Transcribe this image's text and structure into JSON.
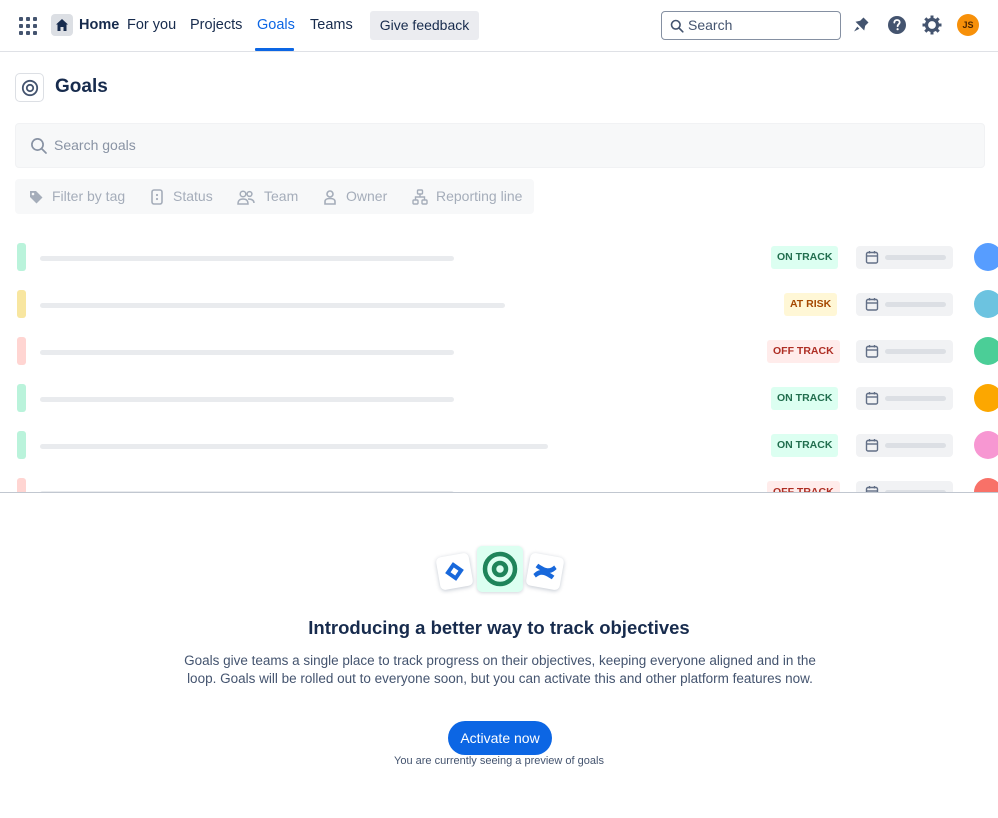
{
  "nav": {
    "home_label": "Home",
    "items": [
      "For you",
      "Projects",
      "Goals",
      "Teams"
    ],
    "active_item": "Goals",
    "feedback_label": "Give feedback",
    "search_placeholder": "Search",
    "user_initials": "JS",
    "avatar_color": "#f79009",
    "accent_color": "#0c66e4"
  },
  "page": {
    "title": "Goals",
    "search_placeholder": "Search goals",
    "filters": [
      {
        "label": "Filter by tag",
        "icon": "tag-icon"
      },
      {
        "label": "Status",
        "icon": "status-icon"
      },
      {
        "label": "Team",
        "icon": "team-icon"
      },
      {
        "label": "Owner",
        "icon": "owner-icon"
      },
      {
        "label": "Reporting line",
        "icon": "reporting-line-icon"
      }
    ]
  },
  "goals": [
    {
      "status": "ON TRACK",
      "status_color": "#216e4e",
      "status_bg": "#dcfff1",
      "stripe": "#baf3db",
      "avatar_color": "#579dff"
    },
    {
      "status": "AT RISK",
      "status_color": "#a54800",
      "status_bg": "#fff7d6",
      "stripe": "#f8e6a0",
      "avatar_color": "#6cc3e0"
    },
    {
      "status": "OFF TRACK",
      "status_color": "#ae2e24",
      "status_bg": "#ffeceb",
      "stripe": "#ffd5d2",
      "avatar_color": "#4bce97"
    },
    {
      "status": "ON TRACK",
      "status_color": "#216e4e",
      "status_bg": "#dcfff1",
      "stripe": "#baf3db",
      "avatar_color": "#fca700"
    },
    {
      "status": "ON TRACK",
      "status_color": "#216e4e",
      "status_bg": "#dcfff1",
      "stripe": "#baf3db",
      "avatar_color": "#f797d2"
    },
    {
      "status": "OFF TRACK",
      "status_color": "#ae2e24",
      "status_bg": "#ffeceb",
      "stripe": "#ffd5d2",
      "avatar_color": "#f87168"
    }
  ],
  "promo": {
    "heading": "Introducing a better way to track objectives",
    "description": "Goals give teams a single place to track progress on their objectives, keeping everyone aligned and in the loop. Goals will be rolled out to everyone soon, but you can activate this and other platform features now.",
    "cta_label": "Activate now",
    "note": "You are currently seeing a preview of goals"
  }
}
